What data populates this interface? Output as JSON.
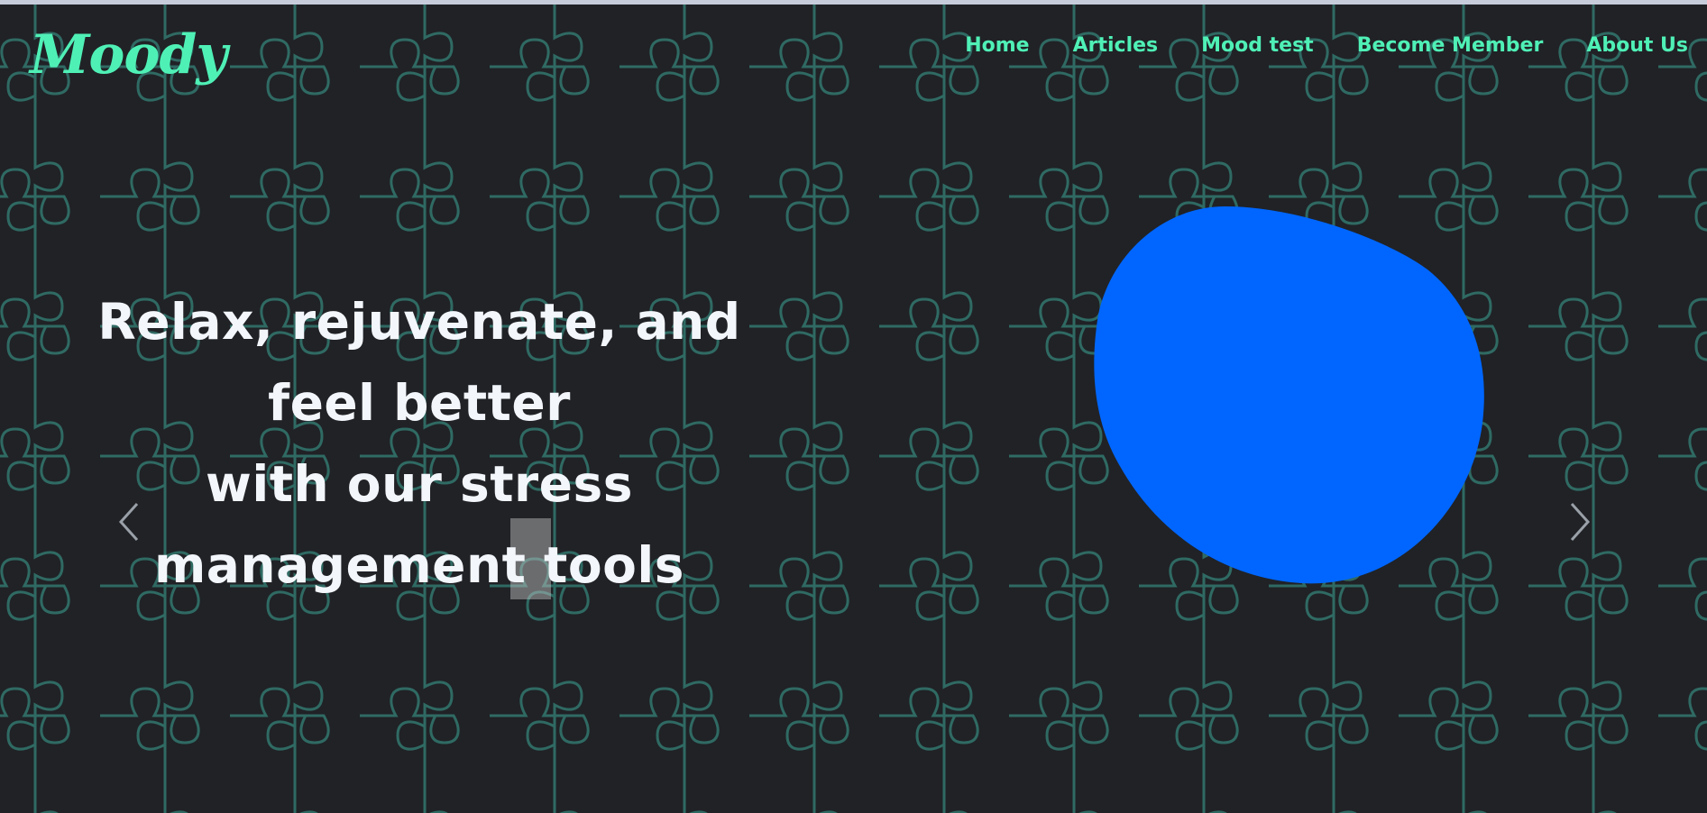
{
  "colors": {
    "accent": "#4ff0b6",
    "background": "#202226",
    "pattern_line": "#2f6a63",
    "blob": "#0066ff",
    "headline": "#f3f6fb"
  },
  "brand": {
    "logo_text": "Moody"
  },
  "nav": {
    "items": [
      {
        "label": "Home"
      },
      {
        "label": "Articles"
      },
      {
        "label": "Mood test"
      },
      {
        "label": "Become Member"
      },
      {
        "label": "About Us"
      }
    ]
  },
  "hero": {
    "lines": [
      "Relax, rejuvenate, and",
      "feel better",
      "with our stress",
      "management tools"
    ]
  },
  "carousel": {
    "prev_icon": "chevron-left-icon",
    "next_icon": "chevron-right-icon"
  }
}
